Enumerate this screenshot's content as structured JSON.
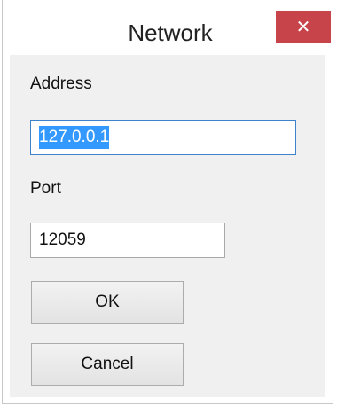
{
  "window": {
    "title": "Network",
    "close_glyph": "✕",
    "colors": {
      "close_button": "#c7454a",
      "selection": "#3399ff",
      "focus_border": "#3c83cc"
    }
  },
  "form": {
    "address_label": "Address",
    "address_value": "127.0.0.1",
    "port_label": "Port",
    "port_value": "12059"
  },
  "buttons": {
    "ok_label": "OK",
    "cancel_label": "Cancel"
  }
}
